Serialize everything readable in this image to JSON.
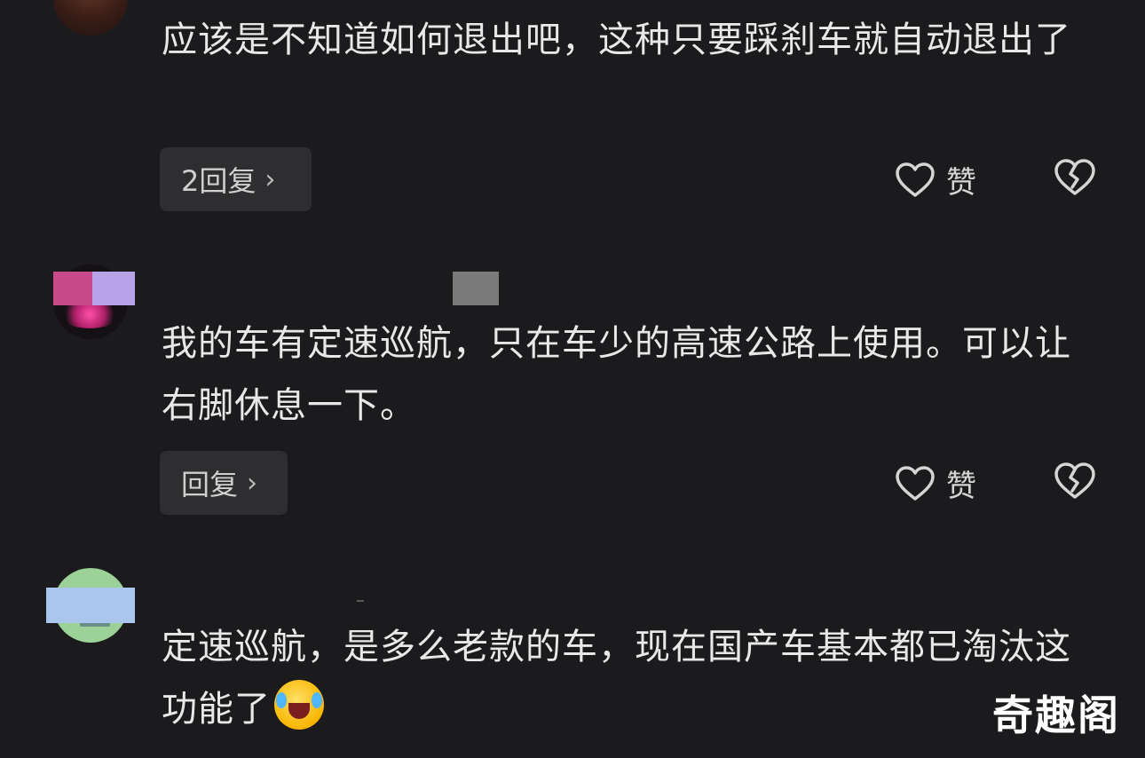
{
  "comments": [
    {
      "text": "应该是不知道如何退出吧，这种只要踩刹车就自动退出了",
      "reply_label": "2回复",
      "like_label": "赞"
    },
    {
      "text": "我的车有定速巡航，只在车少的高速公路上使用。可以让右脚休息一下。",
      "reply_label": "回复",
      "like_label": "赞"
    },
    {
      "text": "定速巡航，是多么老款的车，现在国产车基本都已淘汰这功能了",
      "emoji": "laughing-crying-emoji"
    }
  ],
  "icons": {
    "like": "heart-outline-icon",
    "dislike": "broken-heart-icon",
    "reply_arrow": "chevron-right-icon"
  },
  "watermark": "奇趣阁",
  "colors": {
    "background": "#1b1b1d",
    "reply_button_bg": "#2e2e30",
    "text": "#e8e8e8"
  }
}
